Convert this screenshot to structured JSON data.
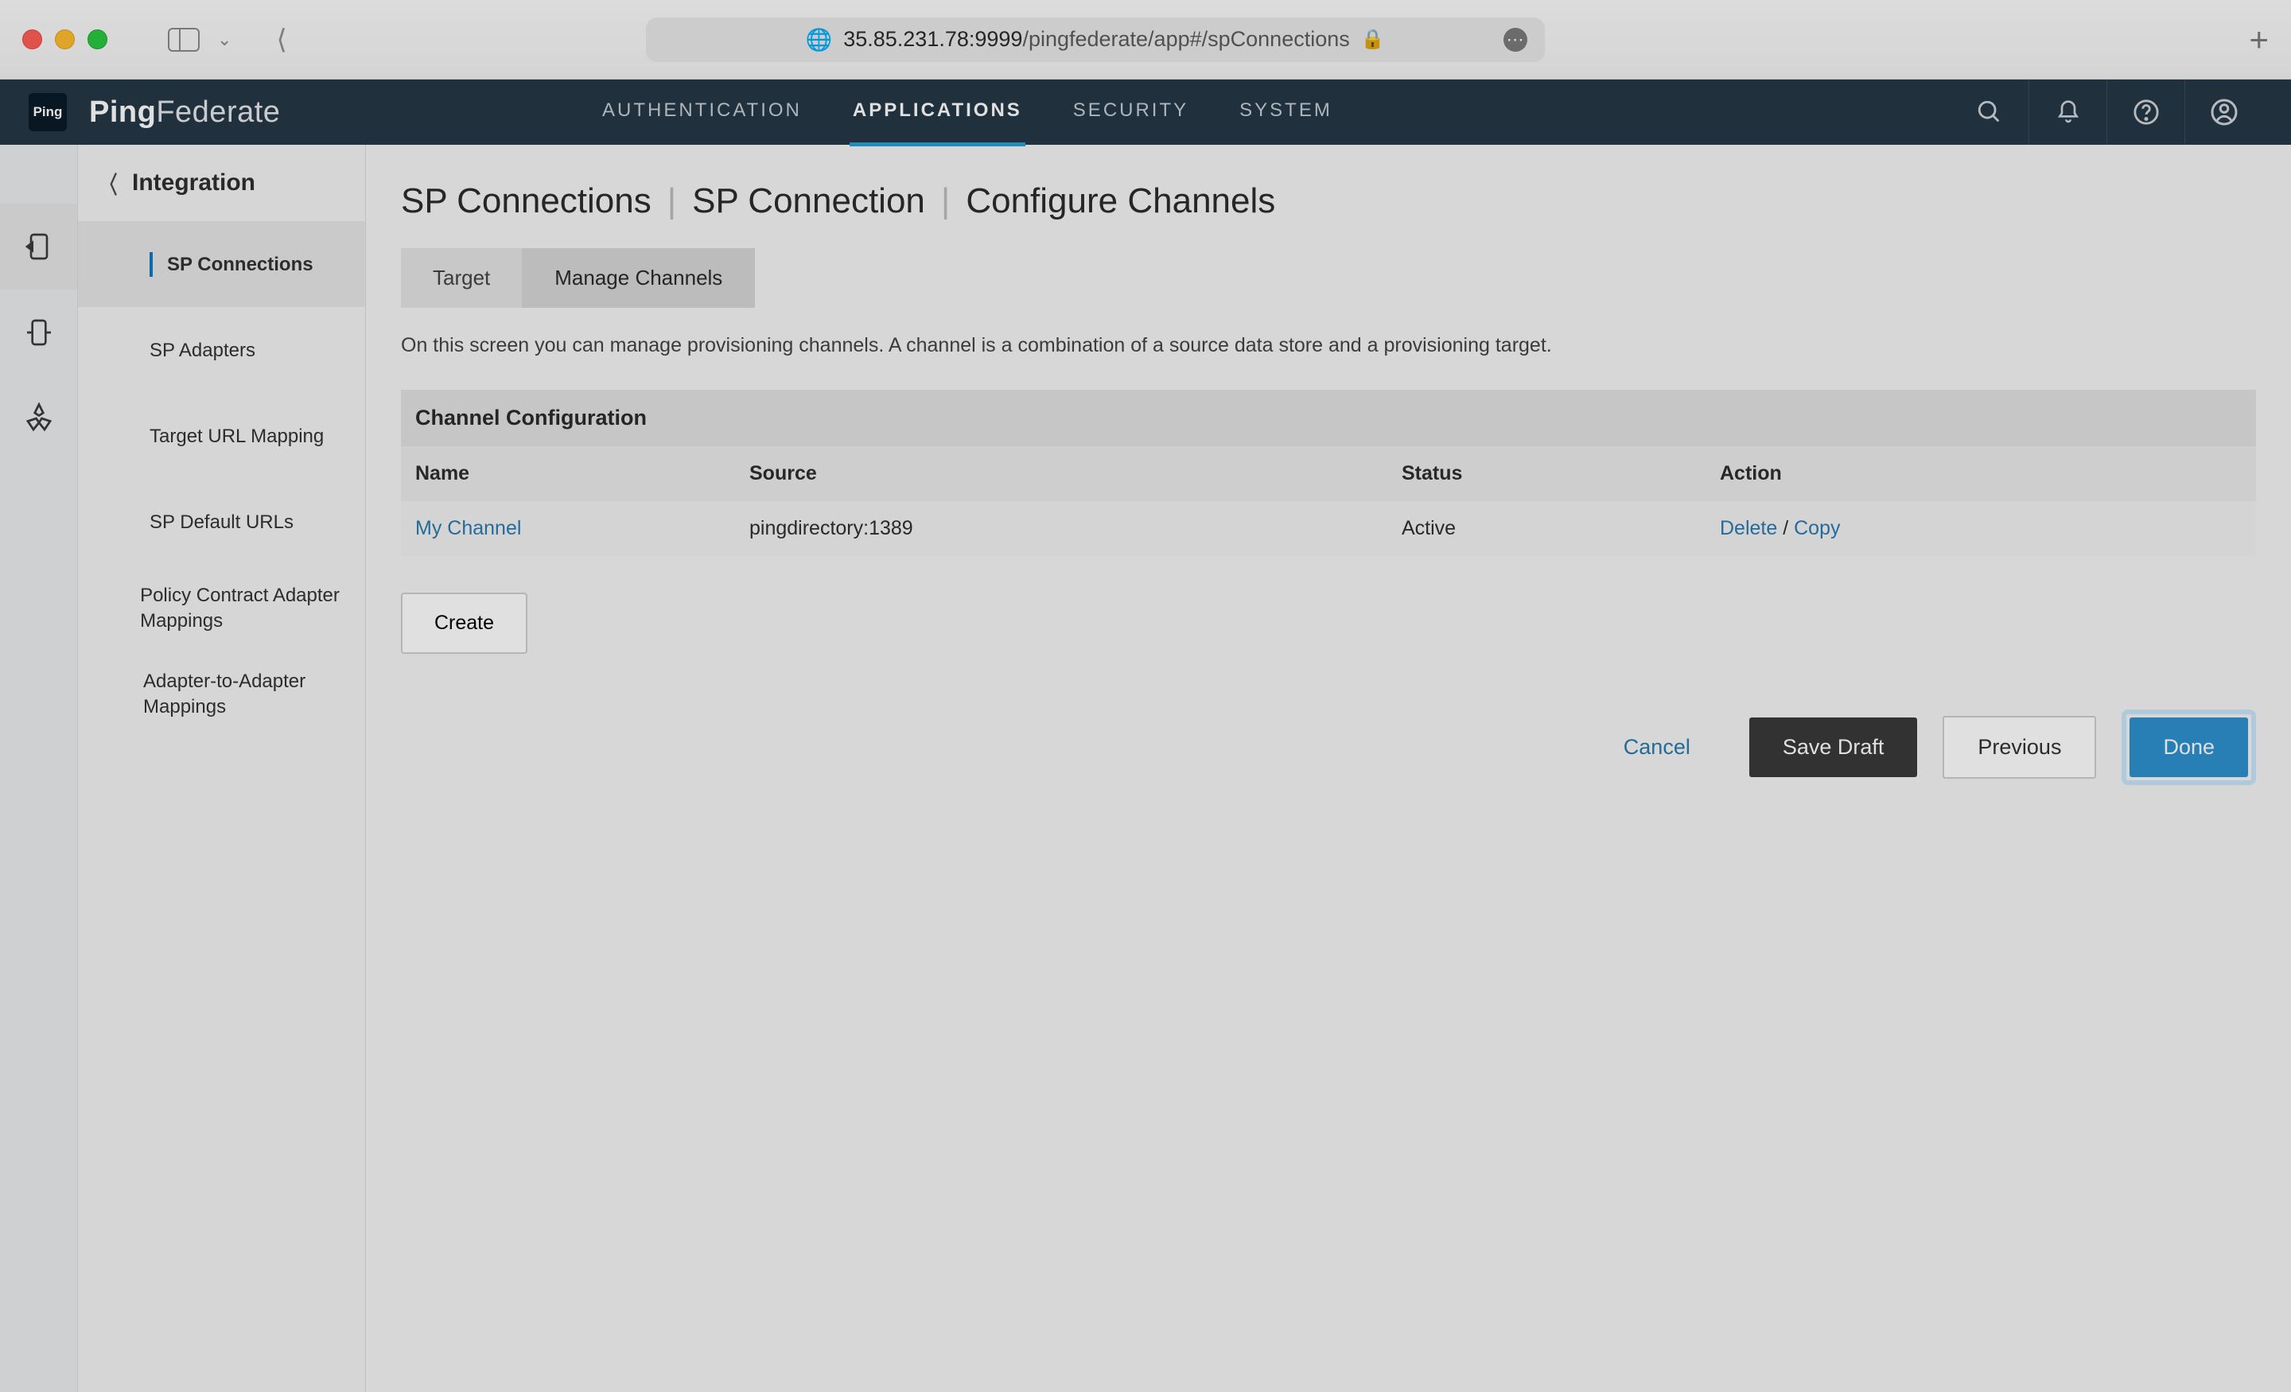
{
  "url": {
    "globe": "🌐",
    "host": "35.85.231.78:9999",
    "path": "/pingfederate/app#/spConnections",
    "lock": "🔒"
  },
  "brand": {
    "bold": "Ping",
    "light": "Federate",
    "logo_text": "Ping"
  },
  "top_nav": [
    "AUTHENTICATION",
    "APPLICATIONS",
    "SECURITY",
    "SYSTEM"
  ],
  "top_nav_active_index": 1,
  "sidebar": {
    "title": "Integration",
    "items": [
      {
        "label": "SP Connections",
        "active": true
      },
      {
        "label": "SP Adapters"
      },
      {
        "label": "Target URL Mapping"
      },
      {
        "label": "SP Default URLs"
      },
      {
        "label": "Policy Contract Adapter Mappings"
      },
      {
        "label": "Adapter-to-Adapter Mappings"
      }
    ]
  },
  "breadcrumbs": [
    "SP Connections",
    "SP Connection",
    "Configure Channels"
  ],
  "tabs": [
    {
      "label": "Target",
      "active": false
    },
    {
      "label": "Manage Channels",
      "active": true
    }
  ],
  "description": "On this screen you can manage provisioning channels. A channel is a combination of a source data store and a provisioning target.",
  "table": {
    "section_title": "Channel Configuration",
    "columns": [
      "Name",
      "Source",
      "Status",
      "Action"
    ],
    "rows": [
      {
        "name": "My Channel",
        "source": "pingdirectory:1389",
        "status": "Active",
        "action_delete": "Delete",
        "action_sep": " / ",
        "action_copy": "Copy"
      }
    ]
  },
  "buttons": {
    "create": "Create",
    "cancel": "Cancel",
    "save_draft": "Save Draft",
    "previous": "Previous",
    "done": "Done"
  }
}
